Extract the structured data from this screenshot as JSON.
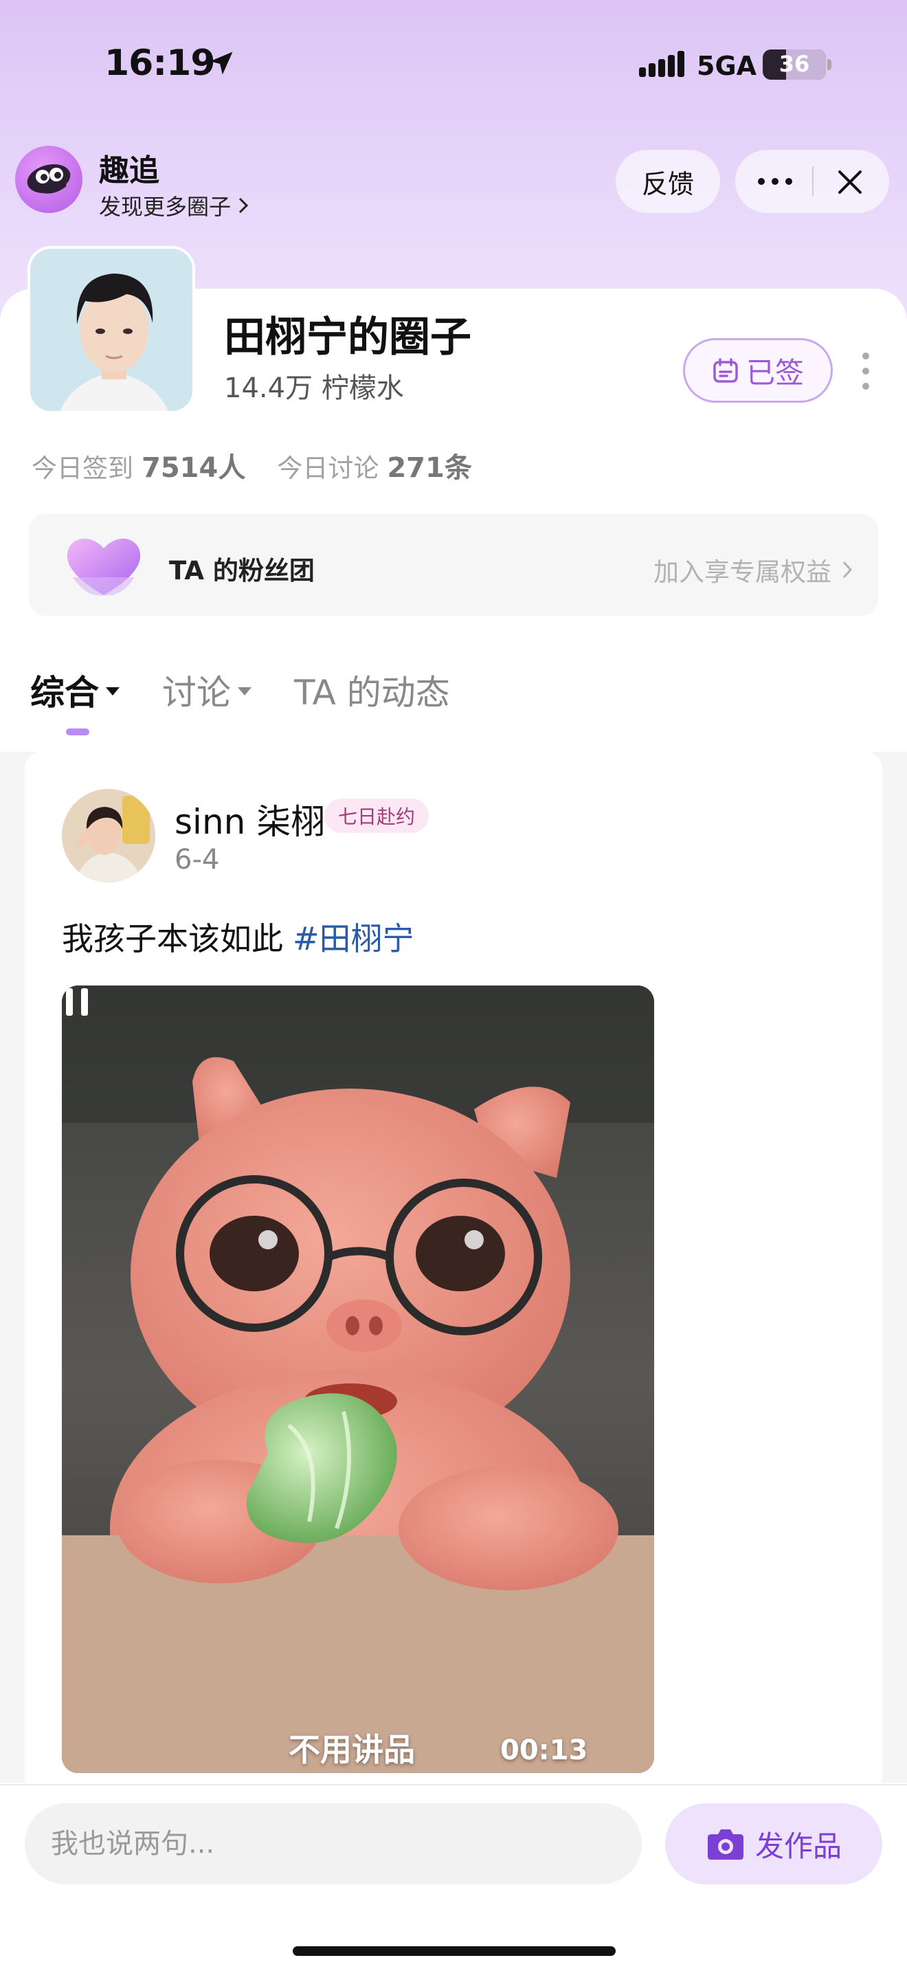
{
  "status_bar": {
    "time": "16:19",
    "network": "5GA",
    "battery": "36"
  },
  "app": {
    "name": "趣追",
    "discover_label": "发现更多圈子"
  },
  "header": {
    "feedback_label": "反馈"
  },
  "circle": {
    "title": "田栩宁的圈子",
    "members": "14.4万 柠檬水",
    "signed_label": "已签",
    "stats": {
      "checkin_label": "今日签到",
      "checkin_value": "7514人",
      "discuss_label": "今日讨论",
      "discuss_value": "271条"
    }
  },
  "fan_club": {
    "label": "TA 的粉丝团",
    "join_label": "加入享专属权益"
  },
  "tabs": [
    {
      "label": "综合",
      "active": true
    },
    {
      "label": "讨论",
      "active": false
    },
    {
      "label": "TA 的动态",
      "active": false
    }
  ],
  "post": {
    "author": "sinn 柒栩",
    "badge": "七日赴约",
    "date": "6-4",
    "text": "我孩子本该如此",
    "hashtag": "#田栩宁",
    "video": {
      "caption": "不用讲品",
      "time": "00:13"
    }
  },
  "bottom_bar": {
    "comment_placeholder": "我也说两句...",
    "post_label": "发作品"
  },
  "colors": {
    "accent": "#9c5ad8",
    "hashtag": "#2a5aa8",
    "badge_text": "#a23c7a"
  }
}
